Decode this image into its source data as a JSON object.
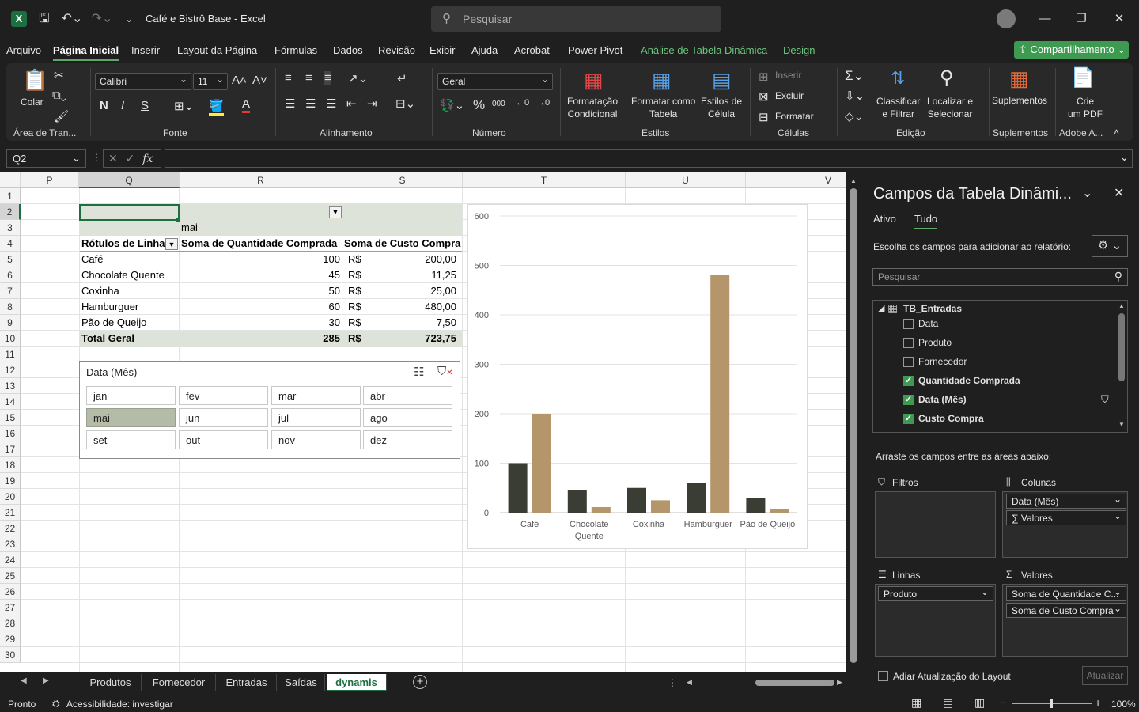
{
  "window": {
    "title": "Café e Bistrô Base  -  Excel",
    "app_icon": "excel-icon",
    "search_placeholder": "Pesquisar"
  },
  "menu": {
    "items": [
      "Arquivo",
      "Página Inicial",
      "Inserir",
      "Layout da Página",
      "Fórmulas",
      "Dados",
      "Revisão",
      "Exibir",
      "Ajuda",
      "Acrobat",
      "Power Pivot",
      "Análise de Tabela Dinâmica",
      "Design"
    ],
    "active": "Página Inicial",
    "share_label": "Compartilhamento"
  },
  "ribbon": {
    "clipboard": {
      "paste_label": "Colar",
      "group": "Área de Tran..."
    },
    "font": {
      "name": "Calibri",
      "size": "11",
      "group": "Fonte",
      "bold": "N",
      "italic": "I",
      "underline": "S"
    },
    "alignment": {
      "group": "Alinhamento"
    },
    "number": {
      "format": "Geral",
      "group": "Número",
      "thousands": "000"
    },
    "styles": {
      "conditional": "Formatação\nCondicional",
      "format_table": "Formatar como\nTabela",
      "cell_styles": "Estilos de\nCélula",
      "group": "Estilos"
    },
    "cells": {
      "insert": "Inserir",
      "delete": "Excluir",
      "format": "Formatar",
      "group": "Células"
    },
    "editing": {
      "sort": "Classificar\ne Filtrar",
      "find": "Localizar e\nSelecionar",
      "group": "Edição"
    },
    "addins": {
      "label": "Suplementos",
      "group": "Suplementos"
    },
    "adobe": {
      "label": "Crie\num PDF",
      "group": "Adobe A..."
    }
  },
  "formula_bar": {
    "name_box": "Q2",
    "formula": "",
    "fx": "fx"
  },
  "columns": [
    "P",
    "Q",
    "R",
    "S",
    "T",
    "U",
    "V"
  ],
  "rows": [
    "1",
    "2",
    "3",
    "4",
    "5",
    "6",
    "7",
    "8",
    "9",
    "10",
    "11",
    "12",
    "13",
    "14",
    "15",
    "16",
    "17",
    "18",
    "19",
    "20",
    "21",
    "22",
    "23",
    "24",
    "25",
    "26",
    "27",
    "28",
    "29",
    "30"
  ],
  "pivot": {
    "filter_value": "mai",
    "header_rows": "Rótulos de Linha",
    "header_qty": "Soma de Quantidade Comprada",
    "header_cost": "Soma de Custo Compra",
    "currency": "R$",
    "rows": [
      {
        "label": "Café",
        "qty": "100",
        "cost": "200,00"
      },
      {
        "label": "Chocolate Quente",
        "qty": "45",
        "cost": "11,25"
      },
      {
        "label": "Coxinha",
        "qty": "50",
        "cost": "25,00"
      },
      {
        "label": "Hamburguer",
        "qty": "60",
        "cost": "480,00"
      },
      {
        "label": "Pão de Queijo",
        "qty": "30",
        "cost": "7,50"
      }
    ],
    "total": {
      "label": "Total Geral",
      "qty": "285",
      "cost": "723,75"
    }
  },
  "slicer": {
    "title": "Data (Mês)",
    "items": [
      "jan",
      "fev",
      "mar",
      "abr",
      "mai",
      "jun",
      "jul",
      "ago",
      "set",
      "out",
      "nov",
      "dez"
    ],
    "selected": "mai"
  },
  "chart_data": {
    "type": "bar",
    "categories": [
      "Café",
      "Chocolate Quente",
      "Coxinha",
      "Hamburguer",
      "Pão de Queijo"
    ],
    "series": [
      {
        "values": [
          100,
          45,
          50,
          60,
          30
        ],
        "color": "#3a3d33"
      },
      {
        "values": [
          200,
          11.25,
          25,
          480,
          7.5
        ],
        "color": "#b5966a"
      }
    ],
    "ylim": [
      0,
      600
    ],
    "yticks": [
      "0",
      "100",
      "200",
      "300",
      "400",
      "500",
      "600"
    ],
    "grid": true
  },
  "pane": {
    "title": "Campos da Tabela Dinâmi...",
    "tab_active": "Ativo",
    "tab_all": "Tudo",
    "choose_label": "Escolha os campos para adicionar ao relatório:",
    "search_placeholder": "Pesquisar",
    "table_name": "TB_Entradas",
    "fields": [
      {
        "name": "Data",
        "checked": false
      },
      {
        "name": "Produto",
        "checked": false
      },
      {
        "name": "Fornecedor",
        "checked": false
      },
      {
        "name": "Quantidade Comprada",
        "checked": true
      },
      {
        "name": "Data (Mês)",
        "checked": true
      },
      {
        "name": "Custo Compra",
        "checked": true
      }
    ],
    "drag_label": "Arraste os campos entre as áreas abaixo:",
    "filters_label": "Filtros",
    "columns_label": "Colunas",
    "columns_items": [
      "Data (Mês)",
      "Valores"
    ],
    "rows_label": "Linhas",
    "rows_items": [
      "Produto"
    ],
    "values_label": "Valores",
    "values_items": [
      "Soma de Quantidade C...",
      "Soma de Custo Compra"
    ],
    "defer_label": "Adiar Atualização do Layout",
    "update_label": "Atualizar"
  },
  "sheets": {
    "tabs": [
      "Produtos",
      "Fornecedor",
      "Entradas",
      "Saídas",
      "dynamis"
    ],
    "active": "dynamis"
  },
  "status": {
    "ready": "Pronto",
    "accessibility": "Acessibilidade: investigar",
    "zoom": "100%"
  }
}
